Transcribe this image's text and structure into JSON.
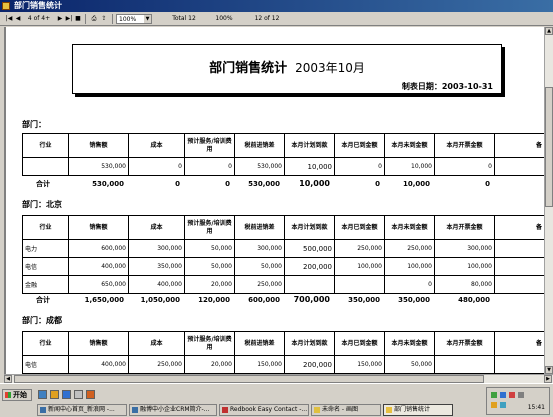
{
  "window": {
    "title": "部门销售统计"
  },
  "toolbar": {
    "page_indicator": "4 of 4+",
    "zoom": "100%",
    "total": "Total 12",
    "percent": "100%",
    "range": "12 of 12"
  },
  "report": {
    "title": "部门销售统计",
    "month": "2003年10月",
    "date_label": "制表日期：2003-10-31",
    "columns": [
      "行业",
      "销售额",
      "成本",
      "预计服务/培训费用",
      "税前进销差",
      "本月计划到款",
      "本月已到金额",
      "本月未到金额",
      "本月开票金额",
      "备"
    ],
    "sections": [
      {
        "label": "部门：",
        "rows": [
          [
            "",
            "530,000",
            "0",
            "0",
            "530,000",
            "10,000",
            "0",
            "10,000",
            "0"
          ]
        ],
        "total": [
          "合计",
          "530,000",
          "0",
          "0",
          "530,000",
          "10,000",
          "0",
          "10,000",
          "0"
        ]
      },
      {
        "label": "部门：北京",
        "rows": [
          [
            "电力",
            "600,000",
            "300,000",
            "50,000",
            "300,000",
            "500,000",
            "250,000",
            "250,000",
            "300,000"
          ],
          [
            "电信",
            "400,000",
            "350,000",
            "50,000",
            "50,000",
            "200,000",
            "100,000",
            "100,000",
            "100,000"
          ],
          [
            "金融",
            "650,000",
            "400,000",
            "20,000",
            "250,000",
            "",
            "",
            "0",
            "80,000"
          ]
        ],
        "total": [
          "合计",
          "1,650,000",
          "1,050,000",
          "120,000",
          "600,000",
          "700,000",
          "350,000",
          "350,000",
          "480,000"
        ]
      },
      {
        "label": "部门：成都",
        "rows": [
          [
            "电信",
            "400,000",
            "250,000",
            "20,000",
            "150,000",
            "200,000",
            "150,000",
            "50,000",
            ""
          ]
        ]
      }
    ]
  },
  "taskbar": {
    "start": "开始",
    "buttons": [
      "新闻中心首页_新浪网 -...",
      "融博中小企业CRM简介-...",
      "Redbook Easy Contact -...",
      "未命名 - 画图",
      "部门销售统计"
    ],
    "clock": "15:41"
  }
}
